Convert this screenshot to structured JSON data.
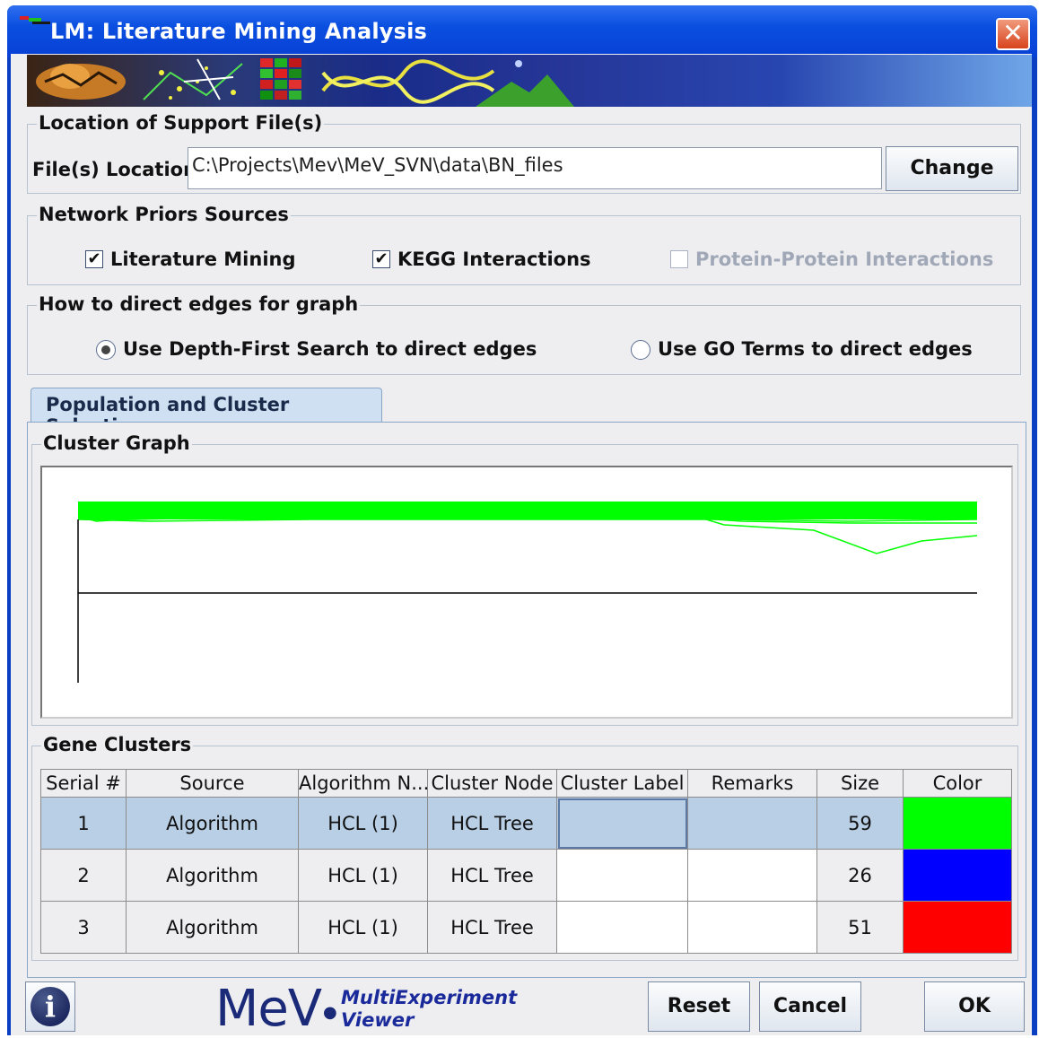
{
  "window": {
    "title": "LM: Literature Mining Analysis"
  },
  "icons": {
    "app": "app-icon",
    "close": "close-icon",
    "info": "info-icon",
    "banner": "banner-image"
  },
  "support_files": {
    "section_title": "Location of Support File(s)",
    "label": "File(s) Location:",
    "path": "C:\\Projects\\Mev\\MeV_SVN\\data\\BN_files",
    "change_label": "Change"
  },
  "network_priors": {
    "section_title": "Network Priors Sources",
    "options": [
      {
        "label": "Literature Mining",
        "checked": true,
        "enabled": true
      },
      {
        "label": "KEGG Interactions",
        "checked": true,
        "enabled": true
      },
      {
        "label": "Protein-Protein Interactions",
        "checked": false,
        "enabled": false
      }
    ]
  },
  "edge_direction": {
    "section_title": "How to direct edges for graph",
    "options": [
      {
        "label": "Use Depth-First Search to direct edges",
        "selected": true
      },
      {
        "label": "Use GO Terms to direct edges",
        "selected": false
      }
    ]
  },
  "tab": {
    "label": "Population and Cluster Selection"
  },
  "cluster_graph": {
    "section_title": "Cluster Graph",
    "line_color": "#00ff00",
    "axis_color": "#000000"
  },
  "gene_clusters": {
    "section_title": "Gene Clusters",
    "columns": [
      "Serial #",
      "Source",
      "Algorithm N...",
      "Cluster Node",
      "Cluster Label",
      "Remarks",
      "Size",
      "Color"
    ],
    "rows": [
      {
        "serial": "1",
        "source": "Algorithm",
        "algorithm": "HCL (1)",
        "node": "HCL Tree",
        "label": "",
        "remarks": "",
        "size": "59",
        "color": "#00ff00"
      },
      {
        "serial": "2",
        "source": "Algorithm",
        "algorithm": "HCL (1)",
        "node": "HCL Tree",
        "label": "",
        "remarks": "",
        "size": "26",
        "color": "#0000ff"
      },
      {
        "serial": "3",
        "source": "Algorithm",
        "algorithm": "HCL (1)",
        "node": "HCL Tree",
        "label": "",
        "remarks": "",
        "size": "51",
        "color": "#ff0000"
      }
    ]
  },
  "footer": {
    "logo_main": "MeV",
    "logo_sub_line1": "MultiExperiment",
    "logo_sub_line2": "Viewer",
    "reset_label": "Reset",
    "cancel_label": "Cancel",
    "ok_label": "OK"
  }
}
